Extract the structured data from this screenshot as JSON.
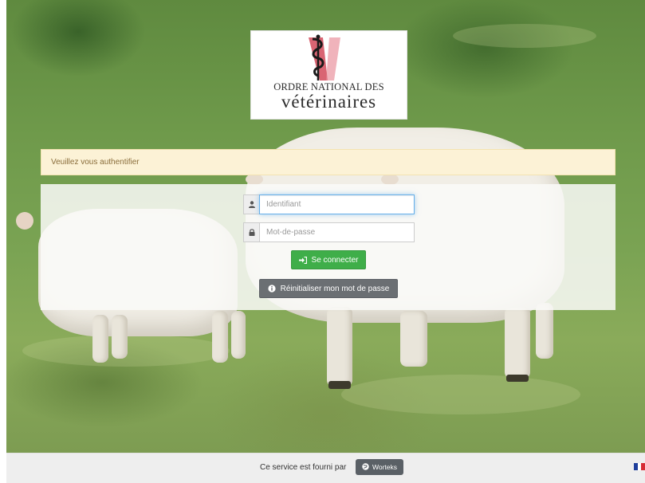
{
  "logo": {
    "line1": "ORDRE NATIONAL DES",
    "line2": "vétérinaires",
    "icon": "caduceus-icon"
  },
  "alert": {
    "message": "Veuillez vous authentifier"
  },
  "login": {
    "username_placeholder": "Identifiant",
    "password_placeholder": "Mot-de-passe",
    "username_value": "",
    "password_value": "",
    "user_icon": "user-icon",
    "lock_icon": "lock-icon",
    "submit_label": "Se connecter",
    "submit_icon": "sign-in-icon",
    "reset_label": "Réinitialiser mon mot de passe",
    "reset_icon": "info-circle-icon"
  },
  "footer": {
    "service_text": "Ce service est fourni par",
    "provider_label": "Worteks",
    "provider_icon": "globe-icon",
    "language_icon": "french-flag-icon"
  },
  "colors": {
    "alert_bg": "#fcf2d6",
    "alert_text": "#8a6d3b",
    "primary_green": "#3fae49",
    "secondary_gray": "#6b6f73",
    "logo_red": "#c3253a"
  }
}
